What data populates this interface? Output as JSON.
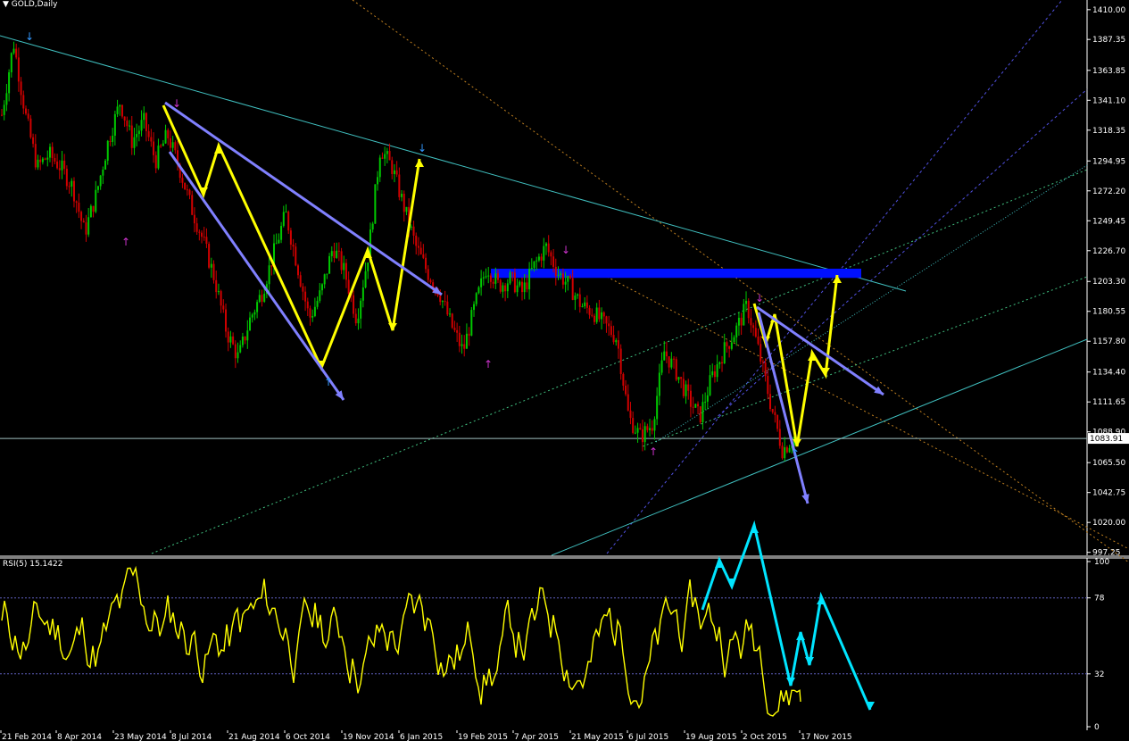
{
  "window": {
    "title_arrow": "▼",
    "symbol_title": "GOLD,Daily"
  },
  "colors": {
    "background": "#000000",
    "axis_text": "#ffffff",
    "candle_up": "#00c800",
    "candle_down": "#d00000",
    "rsi_line": "#ffff00",
    "zigzag": "#ffff00",
    "trend_arrows": "#8080ff",
    "forecast_arrows": "#00e5ff",
    "resistance_zone": "#0010ff",
    "trendline": "#40c0c0",
    "fractal_down": "#cc33cc",
    "fractal_up": "#3399ff"
  },
  "chart_data": [
    {
      "type": "candlestick",
      "title": "GOLD,Daily",
      "x_ticks": [
        "21 Feb 2014",
        "8 Apr 2014",
        "23 May 2014",
        "8 Jul 2014",
        "21 Aug 2014",
        "6 Oct 2014",
        "19 Nov 2014",
        "6 Jan 2015",
        "19 Feb 2015",
        "7 Apr 2015",
        "21 May 2015",
        "6 Jul 2015",
        "19 Aug 2015",
        "2 Oct 2015",
        "17 Nov 2015"
      ],
      "y_ticks": [
        "1410.00",
        "1387.35",
        "1363.85",
        "1341.10",
        "1318.35",
        "1294.95",
        "1272.20",
        "1249.45",
        "1226.70",
        "1203.30",
        "1180.55",
        "1157.80",
        "1134.40",
        "1111.65",
        "1088.90",
        "1065.50",
        "1042.75",
        "1020.00",
        "997.25"
      ],
      "ylim": [
        995,
        1416
      ],
      "current_price": "1083.91",
      "price_path": [
        1330,
        1385,
        1330,
        1290,
        1300,
        1290,
        1275,
        1240,
        1270,
        1310,
        1340,
        1310,
        1325,
        1295,
        1315,
        1290,
        1260,
        1235,
        1205,
        1165,
        1145,
        1175,
        1195,
        1225,
        1255,
        1215,
        1175,
        1195,
        1230,
        1210,
        1175,
        1225,
        1305,
        1290,
        1260,
        1230,
        1210,
        1195,
        1170,
        1150,
        1185,
        1215,
        1200,
        1205,
        1195,
        1215,
        1230,
        1210,
        1200,
        1185,
        1180,
        1170,
        1160,
        1100,
        1085,
        1095,
        1150,
        1135,
        1115,
        1100,
        1130,
        1150,
        1165,
        1185,
        1150,
        1110,
        1075,
        1085
      ],
      "horizontal_line": 1083.91,
      "resistance_zone": [
        1206,
        1213
      ]
    },
    {
      "type": "line",
      "title": "RSI(5) 15.1422",
      "ylim": [
        0,
        100
      ],
      "y_ticks": [
        "100",
        "78",
        "32",
        "0"
      ],
      "levels": [
        78,
        32
      ],
      "series": [
        {
          "name": "RSI(5)",
          "last_value": 15.1422
        }
      ]
    }
  ]
}
